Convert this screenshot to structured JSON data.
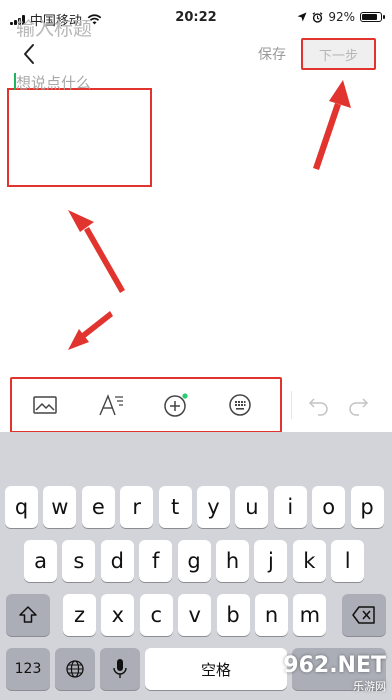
{
  "status_bar": {
    "carrier": "中国移动",
    "time": "20:22",
    "battery": "92%",
    "battery_level": 0.92
  },
  "nav": {
    "save_label": "保存",
    "next_label": "下一步"
  },
  "editor": {
    "title_placeholder": "输入标题",
    "body_placeholder": "想说点什么"
  },
  "toolbar": {
    "tools": [
      "image-icon",
      "text-format-icon",
      "add-circle-icon",
      "more-icon"
    ],
    "actions": [
      "undo-icon",
      "redo-icon"
    ]
  },
  "keyboard": {
    "row1": [
      "q",
      "w",
      "e",
      "r",
      "t",
      "y",
      "u",
      "i",
      "o",
      "p"
    ],
    "row2": [
      "a",
      "s",
      "d",
      "f",
      "g",
      "h",
      "j",
      "k",
      "l"
    ],
    "row3": [
      "z",
      "x",
      "c",
      "v",
      "b",
      "n",
      "m"
    ],
    "numbers_key": "123",
    "space_label": "空格"
  },
  "watermark": {
    "brand": "962.NET",
    "subtitle": "乐游网"
  },
  "colors": {
    "highlight": "#e2342e",
    "caret": "#1fb55d",
    "keyboard_bg": "#d2d4d9"
  }
}
